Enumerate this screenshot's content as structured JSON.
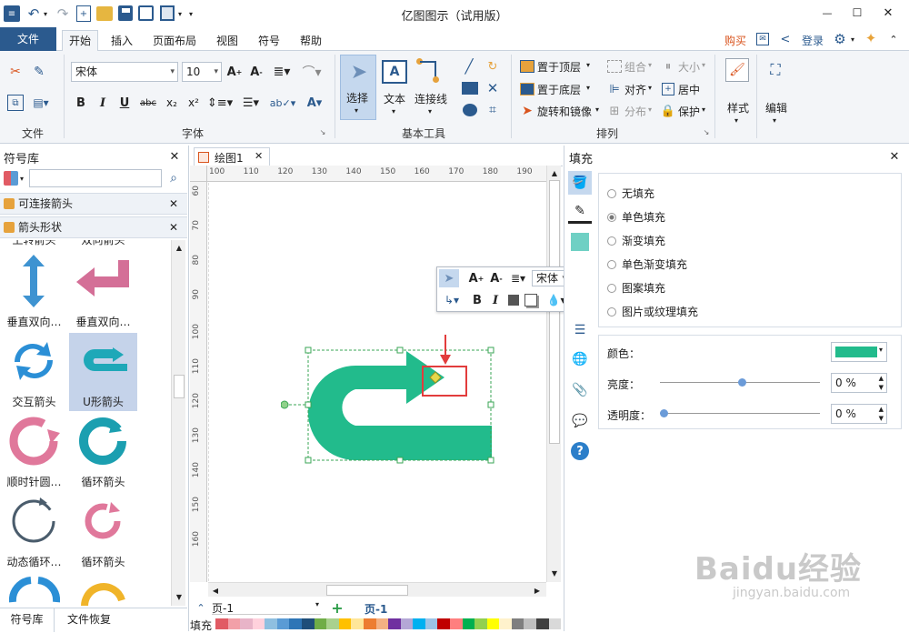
{
  "window": {
    "title": "亿图图示（试用版）"
  },
  "quick_access": {
    "icons": [
      "app-icon",
      "undo-icon",
      "redo-icon",
      "new-icon",
      "open-icon",
      "save-icon",
      "print-icon",
      "save-as-icon",
      "dropdown-icon"
    ]
  },
  "window_controls": {
    "min": "—",
    "max": "☐",
    "close": "✕"
  },
  "tabs": {
    "file": "文件",
    "items": [
      "开始",
      "插入",
      "页面布局",
      "视图",
      "符号",
      "帮助"
    ]
  },
  "account": {
    "buy": "购买",
    "login": "登录"
  },
  "ribbon": {
    "clipboard": {
      "label": "文件"
    },
    "font": {
      "family": "宋体",
      "size": "10",
      "label": "字体"
    },
    "tools": {
      "select": "选择",
      "text": "文本",
      "connector": "连接线",
      "label": "基本工具"
    },
    "arrange": {
      "top": "置于顶层",
      "bottom": "置于底层",
      "rotate": "旋转和镜像",
      "group": "组合",
      "align": "对齐",
      "distribute": "分布",
      "size": "大小",
      "center": "居中",
      "protect": "保护",
      "label": "排列"
    },
    "style": "样式",
    "edit": "编辑"
  },
  "left_panel": {
    "title": "符号库",
    "search_placeholder": "",
    "libraries": [
      "可连接箭头",
      "箭头形状"
    ],
    "shapes": [
      {
        "label": "上转箭头"
      },
      {
        "label": "双向箭头"
      },
      {
        "label": "垂直双向…"
      },
      {
        "label": "垂直双向…"
      },
      {
        "label": "交互箭头"
      },
      {
        "label": "U形箭头"
      },
      {
        "label": "顺时针圆…"
      },
      {
        "label": "循环箭头"
      },
      {
        "label": "动态循环…"
      },
      {
        "label": "循环箭头"
      },
      {
        "label": ""
      },
      {
        "label": ""
      }
    ],
    "bottom_tabs": [
      "符号库",
      "文件恢复"
    ]
  },
  "document": {
    "tab": "绘图1",
    "page": "页-1",
    "page_tab": "页-1",
    "fill_label": "填充"
  },
  "ruler": {
    "h": [
      "100",
      "110",
      "120",
      "130",
      "140",
      "150",
      "160",
      "170",
      "180",
      "190"
    ],
    "v": [
      "60",
      "70",
      "80",
      "90",
      "100",
      "110",
      "120",
      "130",
      "140",
      "150",
      "160"
    ]
  },
  "shape": {
    "color": "#22bb8c"
  },
  "right_panel": {
    "title": "填充",
    "options": [
      "无填充",
      "单色填充",
      "渐变填充",
      "单色渐变填充",
      "图案填充",
      "图片或纹理填充"
    ],
    "selected": 1,
    "color_label": "颜色：",
    "color": "#22bb8c",
    "brightness_label": "亮度：",
    "brightness": "0 %",
    "transparency_label": "透明度：",
    "transparency": "0 %"
  },
  "mini_toolbar": {
    "font": "宋体"
  },
  "watermark": {
    "text": "Baidu经验",
    "url": "jingyan.baidu.com"
  },
  "palette": [
    "#e15b64",
    "#f2a0a8",
    "#e8b4c8",
    "#ffd1dc",
    "#8fbfe0",
    "#5a9bd5",
    "#2e75b6",
    "#1f4e79",
    "#70ad47",
    "#a9d18e",
    "#ffc000",
    "#ffe699",
    "#ed7d31",
    "#f4b183",
    "#7030a0",
    "#b4a7d6",
    "#00b0f0",
    "#9dc3e6",
    "#c00000",
    "#ff7f7f",
    "#00b050",
    "#92d050",
    "#ffff00",
    "#fff2cc",
    "#7f7f7f",
    "#bfbfbf",
    "#404040",
    "#d9d9d9"
  ]
}
